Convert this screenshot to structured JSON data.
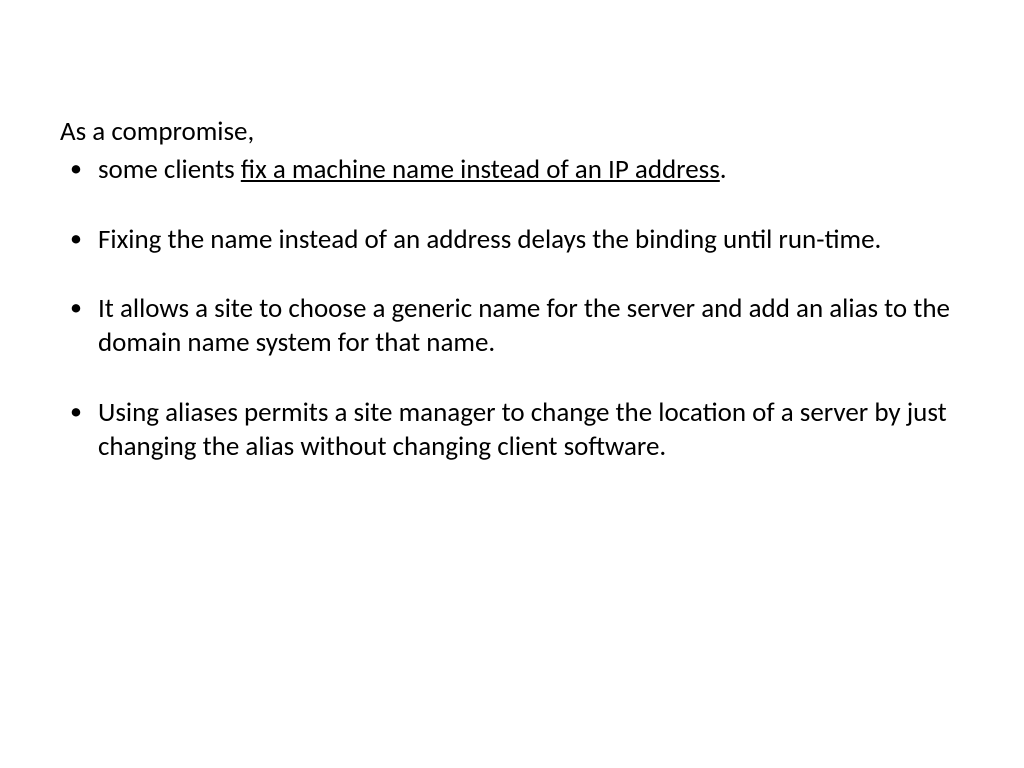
{
  "intro": "As a compromise,",
  "bullets": [
    {
      "prefix": "some clients ",
      "underlined": "fix a machine name instead of an IP address",
      "suffix": "."
    },
    {
      "text": "Fixing the name instead of an address delays the binding until run-time."
    },
    {
      "text": "It allows a site to choose a generic name for the server and add an alias to the domain name system for that name."
    },
    {
      "text": "Using aliases permits a site manager to change the location of a server by just changing the alias without changing client software."
    }
  ]
}
